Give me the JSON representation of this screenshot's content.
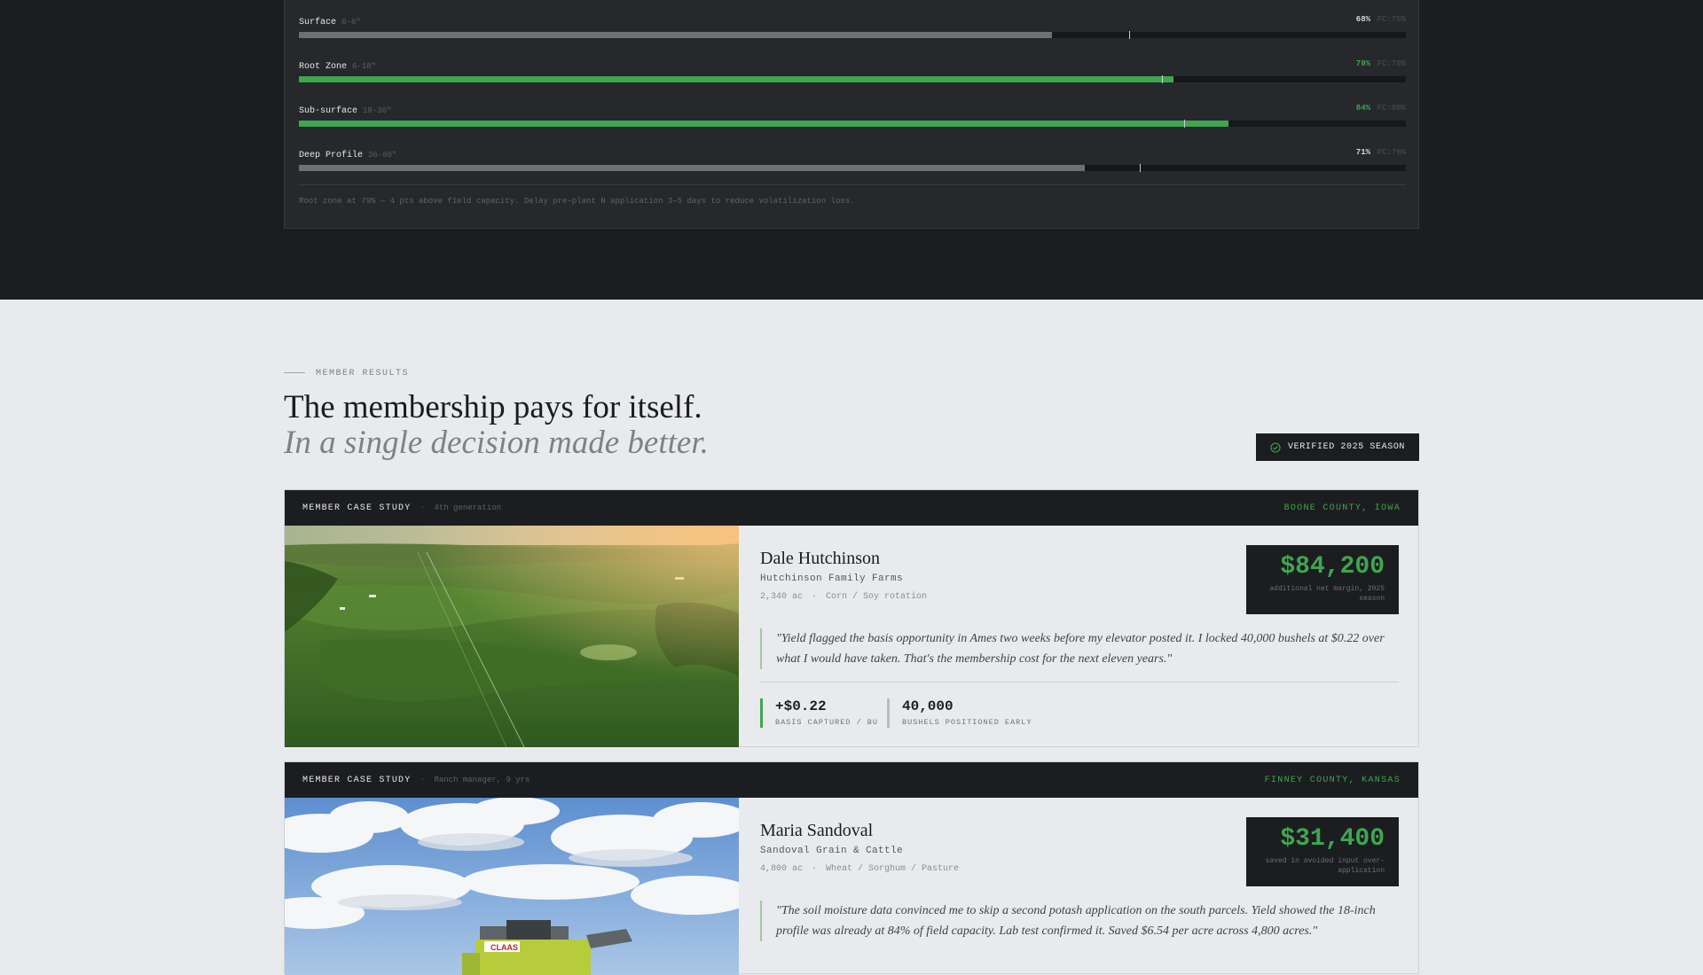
{
  "soil": {
    "layers": [
      {
        "name": "Surface",
        "depth": "0-6\"",
        "pct": "68%",
        "fc": "FC:75%",
        "value": 0.68,
        "fc_value": 0.75,
        "color": "#6d7075",
        "pct_color": "#d5d6d9"
      },
      {
        "name": "Root Zone",
        "depth": "6-18\"",
        "pct": "79%",
        "fc": "FC:78%",
        "value": 0.79,
        "fc_value": 0.78,
        "color": "#3fa64f",
        "pct_color": "#3fa64f"
      },
      {
        "name": "Sub-surface",
        "depth": "18-36\"",
        "pct": "84%",
        "fc": "FC:80%",
        "value": 0.84,
        "fc_value": 0.8,
        "color": "#3fa64f",
        "pct_color": "#3fa64f"
      },
      {
        "name": "Deep Profile",
        "depth": "36-60\"",
        "pct": "71%",
        "fc": "FC:76%",
        "value": 0.71,
        "fc_value": 0.76,
        "color": "#6d7075",
        "pct_color": "#d5d6d9"
      }
    ],
    "note": "Root zone at 79% — 4 pts above field capacity. Delay pre-plant N application 3–5 days to reduce volatilization loss."
  },
  "results": {
    "eyebrow": "MEMBER RESULTS",
    "headline": "The membership pays for itself.",
    "subline": "In a single decision made better.",
    "badge": "VERIFIED 2025 SEASON",
    "badge_icon": "check-circle-icon"
  },
  "cases": [
    {
      "label": "MEMBER CASE STUDY",
      "sub": "4th generation",
      "location": "BOONE COUNTY, IOWA",
      "name": "Dale Hutchinson",
      "farm": "Hutchinson Family Farms",
      "acres": "2,340 ac",
      "crops": "Corn / Soy rotation",
      "amount": "$84,200",
      "amount_caption": "additional net margin, 2025 season",
      "quote": "\"Yield flagged the basis opportunity in Ames two weeks before my elevator posted it. I locked 40,000 bushels at $0.22 over what I would have taken. That's the membership cost for the next eleven years.\"",
      "stats": [
        {
          "value": "+$0.22",
          "caption": "BASIS CAPTURED / BU"
        },
        {
          "value": "40,000",
          "caption": "BUSHELS POSITIONED EARLY"
        }
      ]
    },
    {
      "label": "MEMBER CASE STUDY",
      "sub": "Ranch manager, 9 yrs",
      "location": "FINNEY COUNTY, KANSAS",
      "name": "Maria Sandoval",
      "farm": "Sandoval Grain & Cattle",
      "acres": "4,800 ac",
      "crops": "Wheat / Sorghum / Pasture",
      "amount": "$31,400",
      "amount_caption": "saved in avoided input over-application",
      "quote": "\"The soil moisture data convinced me to skip a second potash application on the south parcels. Yield showed the 18-inch profile was already at 84% of field capacity. Lab test confirmed it. Saved $6.54 per acre across 4,800 acres.\"",
      "machine_text": "CLAAS"
    }
  ]
}
